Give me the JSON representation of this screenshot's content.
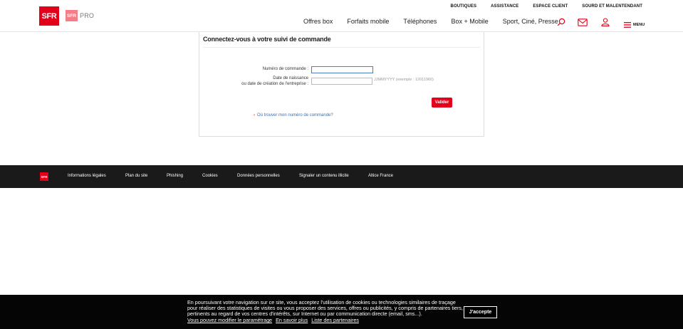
{
  "header": {
    "logo_text": "SFR",
    "pro_logo_box": "SFR",
    "pro_logo_text": "PRO",
    "top_links": [
      "BOUTIQUES",
      "ASSISTANCE",
      "ESPACE CLIENT",
      "SOURD ET MALENTENDANT"
    ],
    "nav": [
      "Offres box",
      "Forfaits mobile",
      "Téléphones",
      "Box + Mobile",
      "Sport, Ciné, Presse"
    ],
    "icons": [
      "search-icon",
      "mail-icon",
      "user-icon",
      "menu-icon"
    ],
    "menu_label": "MENU"
  },
  "form": {
    "title": "Connectez-vous à votre suivi de commande",
    "order_label": "Numéro de commande :",
    "order_value": "",
    "date_label_line1": "Date de naissance",
    "date_label_line2": "ou date de création de l'entreprise :",
    "date_value": "",
    "date_hint": "JJMMYYYY (exemple : 12011960)",
    "submit_label": "Valider",
    "help_link": "Où trouver mon numéro de commande?"
  },
  "footer": {
    "logo_text": "SFR",
    "links": [
      "Informations légales",
      "Plan du site",
      "Phishing",
      "Cookies",
      "Données personnelles",
      "Signaler un contenu illicite",
      "Altice France"
    ]
  },
  "cookie_banner": {
    "text": "En poursuivant votre navigation sur ce site, vous acceptez l'utilisation de cookies ou technologies similaires de traçage pour réaliser des statistiques de visites ou vous proposer des services, offres ou publicités, y compris de partenaires tiers, pertinents au regard de vos centres d'intérêts, sur Internet ou par communication directe (email, sms...).",
    "links": [
      "Vous pouvez modifier le paramétrage",
      "En savoir plus",
      "Liste des partenaires"
    ],
    "accept_label": "J'accepte"
  },
  "colors": {
    "brand_red": "#e2001a",
    "pro_pink": "#f47e88",
    "link_blue": "#3f6fa8",
    "footer_bg": "#1a1a1a",
    "banner_bg": "#050505"
  }
}
